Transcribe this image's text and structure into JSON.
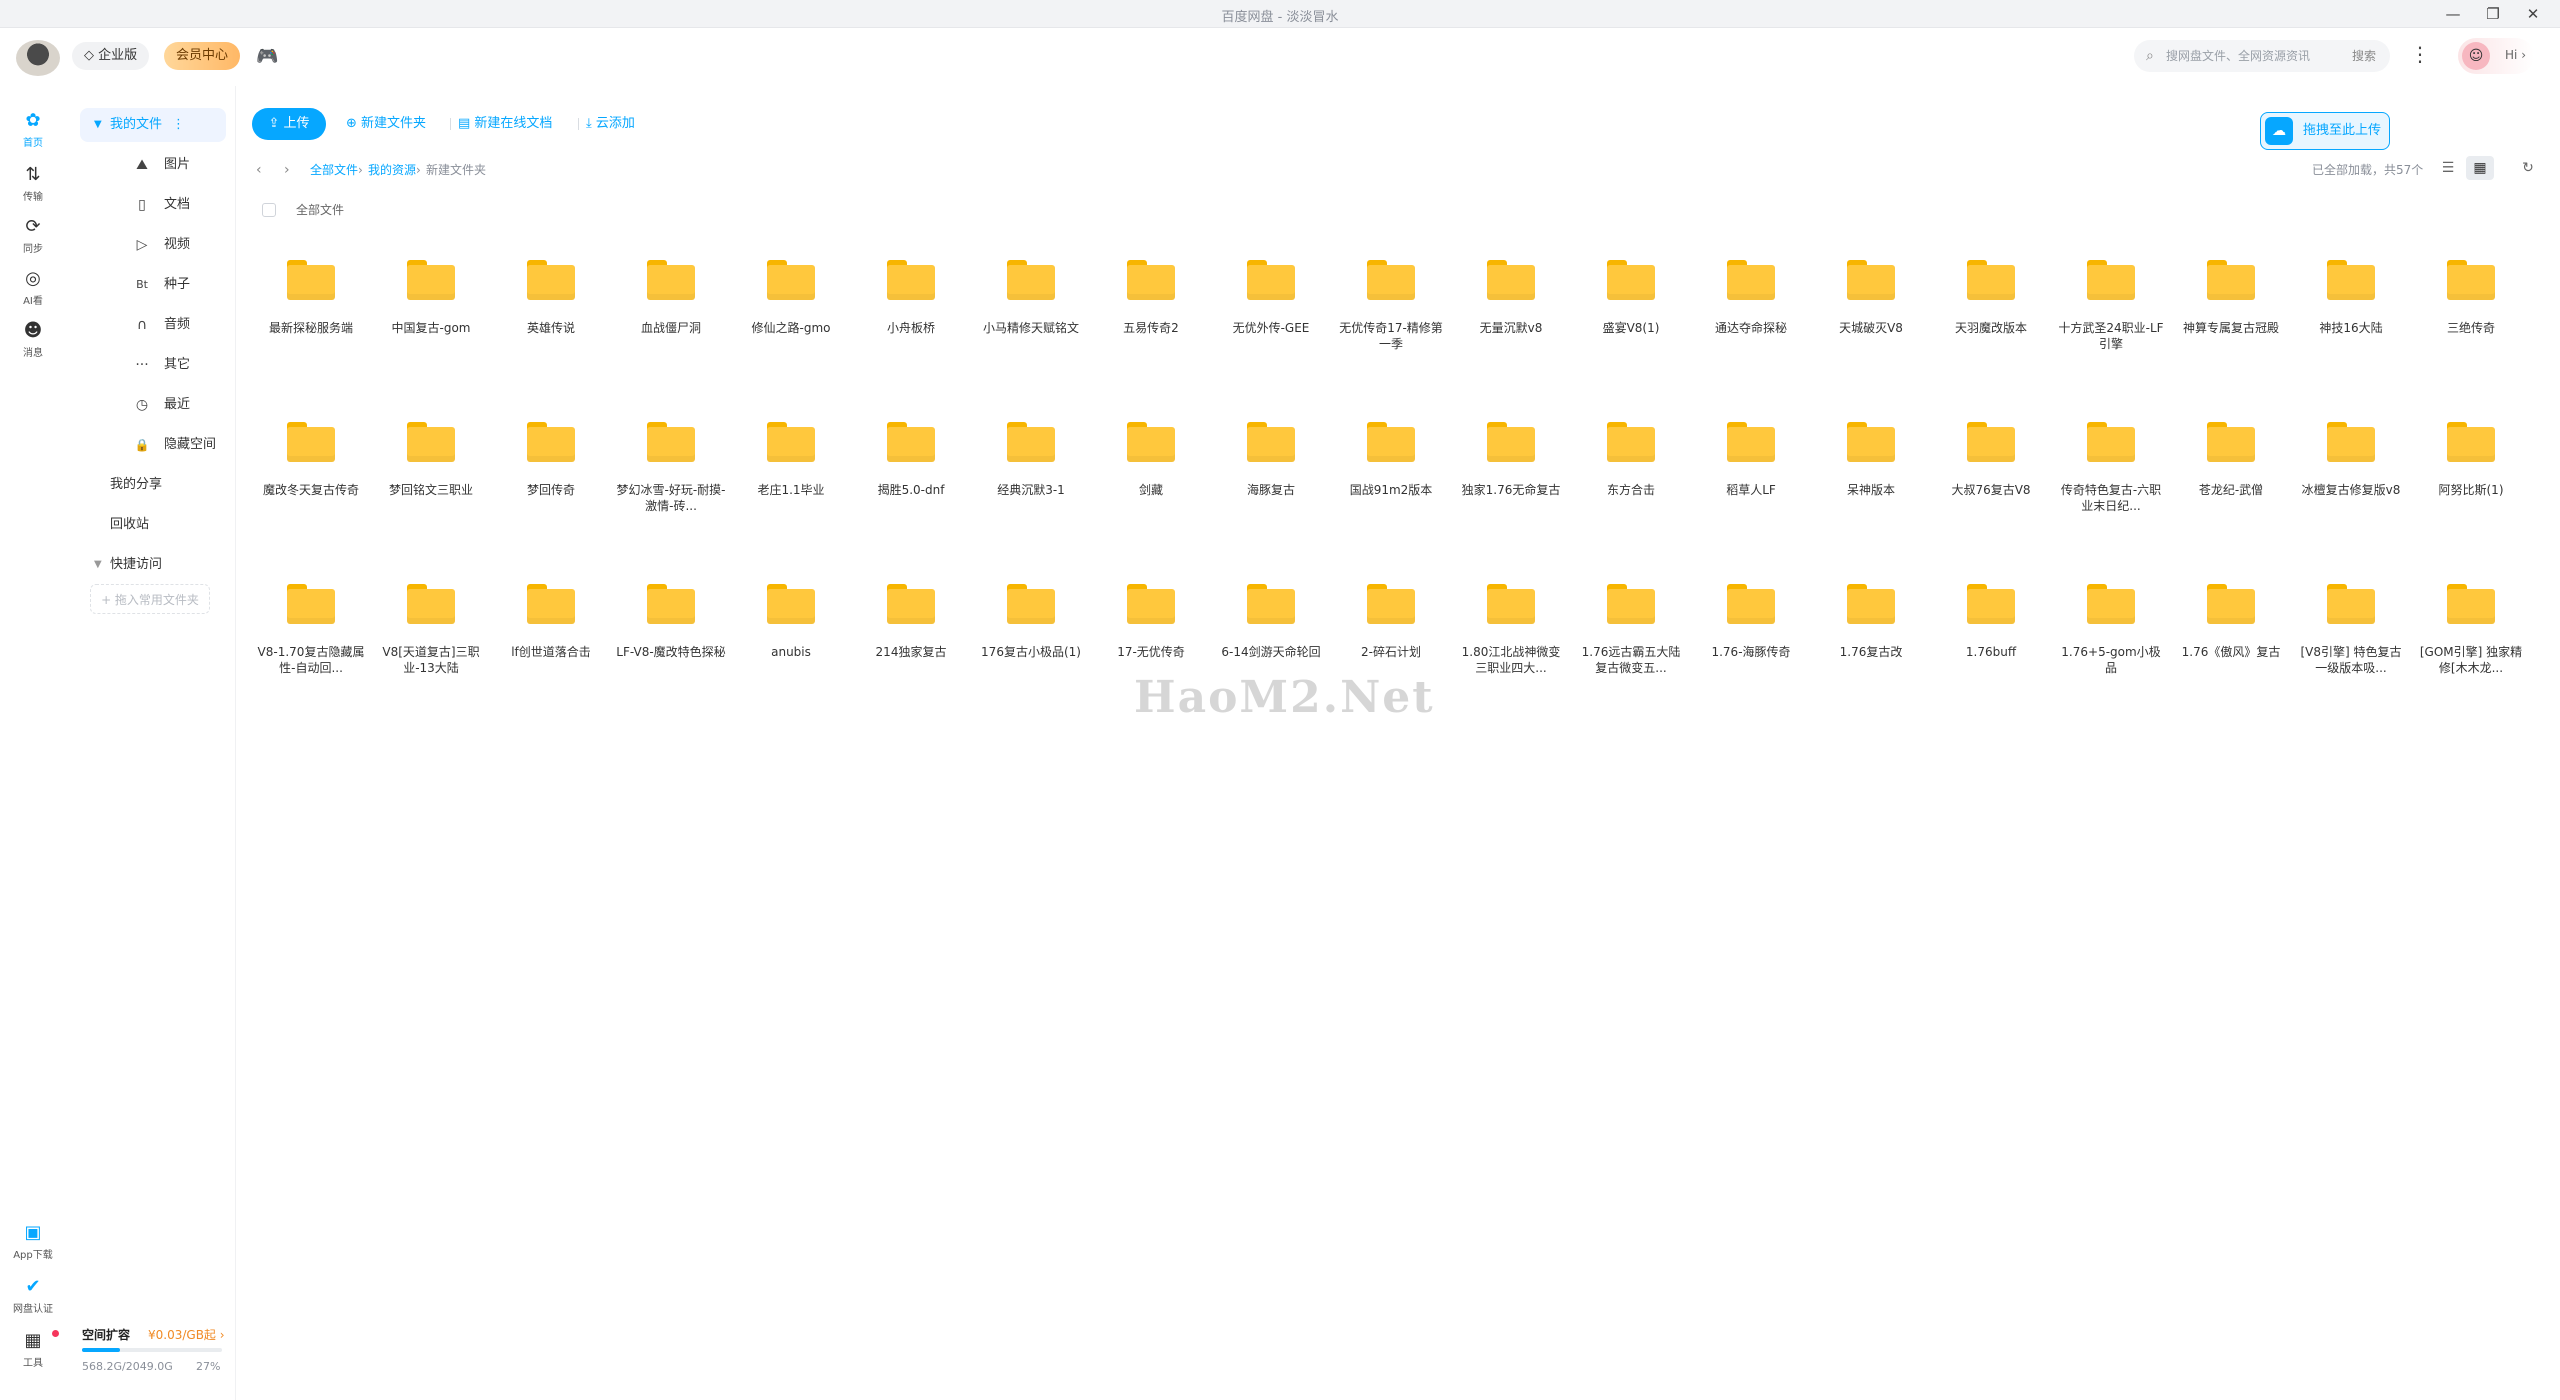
{
  "window": {
    "title": "百度网盘 - 淡淡冒水"
  },
  "header": {
    "enterprise_label": "企业版",
    "vip_label": "会员中心",
    "search_placeholder": "搜网盘文件、全网资源资讯",
    "search_button": "搜索",
    "greeting": "Hi"
  },
  "rail": {
    "items": [
      {
        "label": "首页",
        "icon": "home-icon"
      },
      {
        "label": "传输",
        "icon": "transfer-icon"
      },
      {
        "label": "同步",
        "icon": "sync-icon"
      },
      {
        "label": "AI看",
        "icon": "ai-icon"
      },
      {
        "label": "消息",
        "icon": "message-icon"
      }
    ],
    "bottom": [
      {
        "label": "App下载",
        "icon": "app-icon"
      },
      {
        "label": "网盘认证",
        "icon": "verify-icon"
      },
      {
        "label": "工具",
        "icon": "tools-icon"
      }
    ]
  },
  "sidebar": {
    "my_files": "我的文件",
    "categories": [
      {
        "label": "图片",
        "glyph": "⛰"
      },
      {
        "label": "文档",
        "glyph": "▯"
      },
      {
        "label": "视频",
        "glyph": "▷"
      },
      {
        "label": "种子",
        "glyph": "Bt"
      },
      {
        "label": "音频",
        "glyph": "∩"
      },
      {
        "label": "其它",
        "glyph": "···"
      },
      {
        "label": "最近",
        "glyph": "◷"
      },
      {
        "label": "隐藏空间",
        "glyph": "🔒"
      }
    ],
    "my_share": "我的分享",
    "recycle": "回收站",
    "quick_access": "快捷访问",
    "add_placeholder": "+ 拖入常用文件夹",
    "quota_title": "空间扩容",
    "quota_price": "¥0.03/GB起 ›",
    "quota_used": "568.2G/2049.0G",
    "quota_percent": "27%",
    "quota_fraction": 0.27
  },
  "toolbar": {
    "upload": "上传",
    "new_folder": "新建文件夹",
    "new_online_doc": "新建在线文档",
    "cloud_add": "云添加",
    "drag_upload": "拖拽至此上传"
  },
  "breadcrumb": {
    "all_files": "全部文件",
    "my_resources": "我的资源",
    "current": "新建文件夹",
    "loaded": "已全部加载，共57个"
  },
  "list": {
    "header": "全部文件"
  },
  "folders": [
    "最新探秘服务端",
    "中国复古-gom",
    "英雄传说",
    "血战僵尸洞",
    "修仙之路-gmo",
    "小舟板桥",
    "小马精修天赋铭文",
    "五易传奇2",
    "无优外传-GEE",
    "无优传奇17-精修第一季",
    "无量沉默v8",
    "盛宴V8(1)",
    "通达夺命探秘",
    "天城破灭V8",
    "天羽魔改版本",
    "十方武圣24职业-LF引擎",
    "神算专属复古冠殿",
    "神技16大陆",
    "三绝传奇",
    "魔改冬天复古传奇",
    "梦回铭文三职业",
    "梦回传奇",
    "梦幻冰雪-好玩-耐摸-激情-砖...",
    "老庄1.1毕业",
    "揭胜5.0-dnf",
    "经典沉默3-1",
    "剑藏",
    "海豚复古",
    "国战91m2版本",
    "独家1.76无命复古",
    "东方合击",
    "稻草人LF",
    "呆神版本",
    "大叔76复古V8",
    "传奇特色复古-六职业末日纪...",
    "苍龙纪-武僧",
    "冰檀复古修复版v8",
    "阿努比斯(1)",
    "V8-1.70复古隐藏属性-自动回...",
    "V8[天道复古]三职业-13大陆",
    "lf创世道落合击",
    "LF-V8-魔改特色探秘",
    "anubis",
    "214独家复古",
    "176复古小极品(1)",
    "17-无优传奇",
    "6-14剑游天命轮回",
    "2-碎石计划",
    "1.80江北战神微变三职业四大...",
    "1.76远古霸五大陆复古微变五...",
    "1.76-海豚传奇",
    "1.76复古改",
    "1.76buff",
    "1.76+5-gom小极品",
    "1.76《傲风》复古",
    "[V8引擎] 特色复古一级版本吸...",
    "[GOM引擎] 独家精修[木木龙..."
  ],
  "watermark": "HaoM2.Net"
}
